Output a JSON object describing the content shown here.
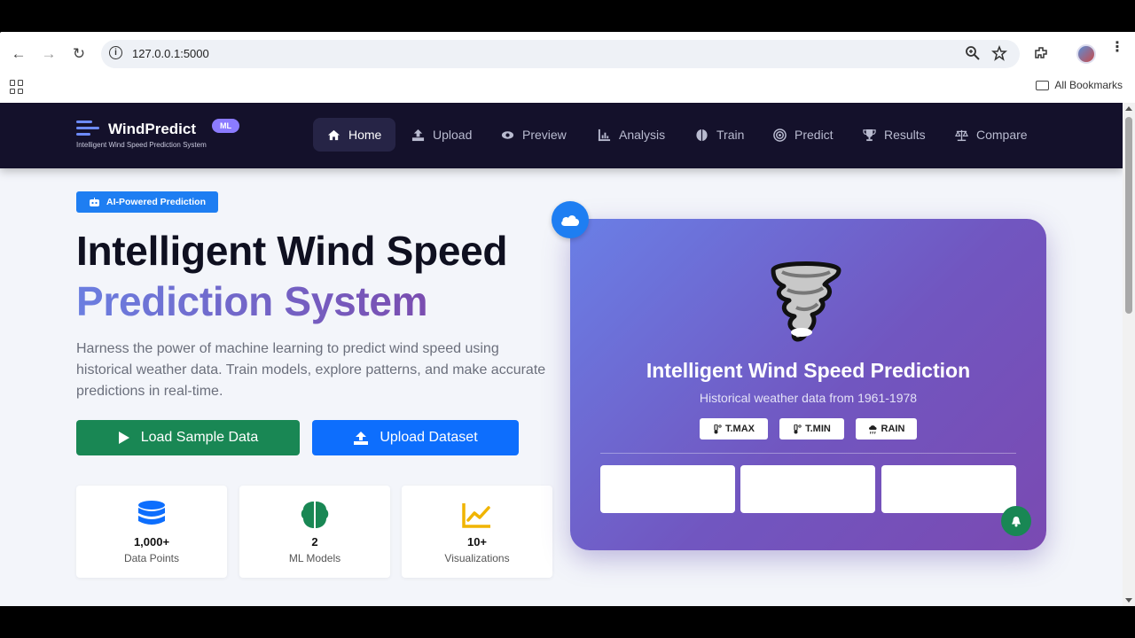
{
  "browser": {
    "url": "127.0.0.1:5000",
    "bookmarks_label": "All Bookmarks"
  },
  "nav": {
    "brand": "WindPredict",
    "badge": "ML",
    "tagline": "Intelligent Wind Speed Prediction System",
    "items": [
      {
        "label": "Home",
        "icon": "home-icon",
        "active": true
      },
      {
        "label": "Upload",
        "icon": "upload-icon"
      },
      {
        "label": "Preview",
        "icon": "eye-icon"
      },
      {
        "label": "Analysis",
        "icon": "chart-icon"
      },
      {
        "label": "Train",
        "icon": "brain-icon"
      },
      {
        "label": "Predict",
        "icon": "target-icon"
      },
      {
        "label": "Results",
        "icon": "trophy-icon"
      },
      {
        "label": "Compare",
        "icon": "scale-icon"
      }
    ]
  },
  "hero": {
    "pill": "AI-Powered Prediction",
    "title_line1": "Intelligent Wind Speed",
    "title_line2": "Prediction System",
    "description": "Harness the power of machine learning to predict wind speed using historical weather data. Train models, explore patterns, and make accurate predictions in real-time.",
    "load_button": "Load Sample Data",
    "upload_button": "Upload Dataset"
  },
  "stats": [
    {
      "value": "1,000+",
      "label": "Data Points",
      "icon": "database-icon",
      "color": "#0d6efd"
    },
    {
      "value": "2",
      "label": "ML Models",
      "icon": "brain-icon",
      "color": "#198754"
    },
    {
      "value": "10+",
      "label": "Visualizations",
      "icon": "chart-line-icon",
      "color": "#f0b400"
    }
  ],
  "card": {
    "title": "Intelligent Wind Speed Prediction",
    "subtitle": "Historical weather data from 1961-1978",
    "chips": [
      "T.MAX",
      "T.MIN",
      "RAIN"
    ]
  },
  "colors": {
    "nav_bg": "#14112b",
    "accent_blue": "#0d6efd",
    "accent_green": "#198754",
    "card_gradient_start": "#6a7fe6",
    "card_gradient_end": "#7a4ab2"
  }
}
